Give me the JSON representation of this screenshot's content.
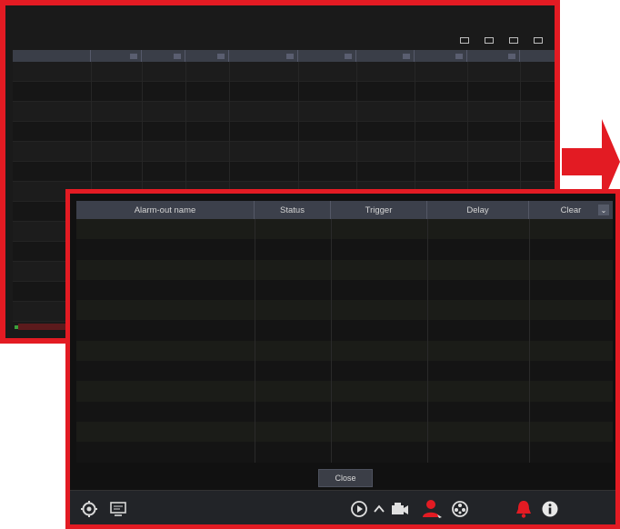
{
  "back_window": {
    "title": "",
    "toolbar": [
      "",
      "",
      "",
      ""
    ],
    "columns": [
      "",
      "",
      "",
      "",
      "",
      "",
      "",
      "",
      "",
      "",
      ""
    ]
  },
  "dialog": {
    "columns": [
      "Alarm-out name",
      "Status",
      "Trigger",
      "Delay",
      "Clear"
    ],
    "close_label": "Close"
  },
  "taskbar": {
    "left_icons": [
      "settings-icon",
      "monitor-icon"
    ],
    "right_icons": [
      "play-icon",
      "expand-up-icon",
      "camera-icon",
      "alarm-user-icon",
      "camera-reel-icon",
      "alarm-bell-icon",
      "info-icon"
    ]
  },
  "colors": {
    "highlight_border": "#e31b23",
    "background": "#111111",
    "header": "#3c404b",
    "alarm_red": "#e31b23"
  }
}
